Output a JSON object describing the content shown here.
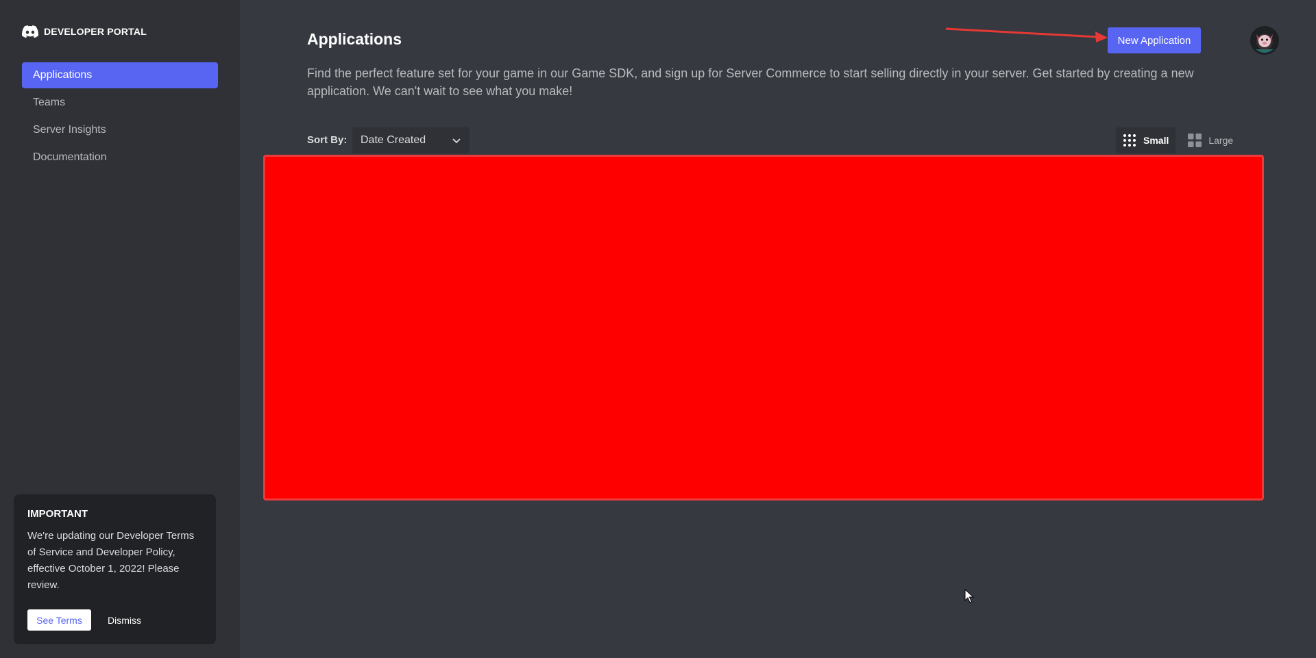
{
  "sidebar": {
    "brand": {
      "label": "DEVELOPER PORTAL",
      "icon": "discord-logo-icon"
    },
    "nav": [
      {
        "label": "Applications",
        "active": true
      },
      {
        "label": "Teams",
        "active": false
      },
      {
        "label": "Server Insights",
        "active": false
      },
      {
        "label": "Documentation",
        "active": false
      }
    ],
    "notice": {
      "title": "IMPORTANT",
      "body": "We're updating our Developer Terms of Service and Developer Policy, effective October 1, 2022! Please review.",
      "see_terms_label": "See Terms",
      "dismiss_label": "Dismiss"
    }
  },
  "header": {
    "title": "Applications",
    "new_application_label": "New Application",
    "description": "Find the perfect feature set for your game in our Game SDK, and sign up for Server Commerce to start selling directly in your server. Get started by creating a new application. We can't wait to see what you make!"
  },
  "toolbar": {
    "sort_label": "Sort By:",
    "sort_value": "Date Created",
    "view_small_label": "Small",
    "view_large_label": "Large",
    "active_view": "Small"
  },
  "colors": {
    "accent": "#5865f2",
    "sidebar_bg": "#2f3136",
    "main_bg": "#36393f",
    "notice_bg": "#202225",
    "redaction": "#ff0000",
    "annotation_arrow": "#e53935"
  }
}
